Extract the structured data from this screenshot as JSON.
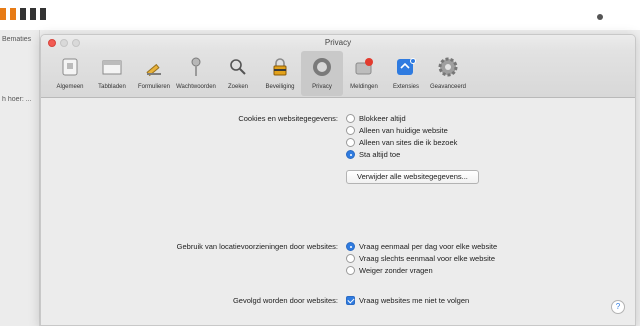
{
  "background": {
    "left_texts": [
      "Bematies",
      "h hoer: ..."
    ]
  },
  "window": {
    "title": "Privacy",
    "tabs": [
      {
        "label": "Algemeen",
        "icon": "general-switch-icon",
        "active": false
      },
      {
        "label": "Tabbladen",
        "icon": "tabs-icon",
        "active": false
      },
      {
        "label": "Formulieren",
        "icon": "pencil-icon",
        "active": false
      },
      {
        "label": "Wachtwoorden",
        "icon": "key-icon",
        "active": false
      },
      {
        "label": "Zoeken",
        "icon": "magnifier-icon",
        "active": false
      },
      {
        "label": "Beveiliging",
        "icon": "lock-icon",
        "active": false
      },
      {
        "label": "Privacy",
        "icon": "privacy-hand-icon",
        "active": true
      },
      {
        "label": "Meldingen",
        "icon": "notifications-icon",
        "active": false
      },
      {
        "label": "Extensies",
        "icon": "extensions-icon",
        "active": false
      },
      {
        "label": "Geavanceerd",
        "icon": "gear-icon",
        "active": false
      }
    ]
  },
  "cookies": {
    "label": "Cookies en websitegegevens:",
    "options": [
      {
        "label": "Blokkeer altijd",
        "selected": false
      },
      {
        "label": "Alleen van huidige website",
        "selected": false
      },
      {
        "label": "Alleen van sites die ik bezoek",
        "selected": false
      },
      {
        "label": "Sta altijd toe",
        "selected": true
      }
    ],
    "remove_button": "Verwijder alle websitegegevens..."
  },
  "location": {
    "label": "Gebruik van locatievoorzieningen door websites:",
    "options": [
      {
        "label": "Vraag eenmaal per dag voor elke website",
        "selected": true
      },
      {
        "label": "Vraag slechts eenmaal voor elke website",
        "selected": false
      },
      {
        "label": "Weiger zonder vragen",
        "selected": false
      }
    ]
  },
  "tracking": {
    "label": "Gevolgd worden door websites:",
    "checkbox_label": "Vraag websites me niet te volgen",
    "checked": true
  },
  "help_label": "?",
  "colors": {
    "accent": "#2f7be0",
    "close": "#f25b53",
    "brand_orange": "#e77b16"
  }
}
